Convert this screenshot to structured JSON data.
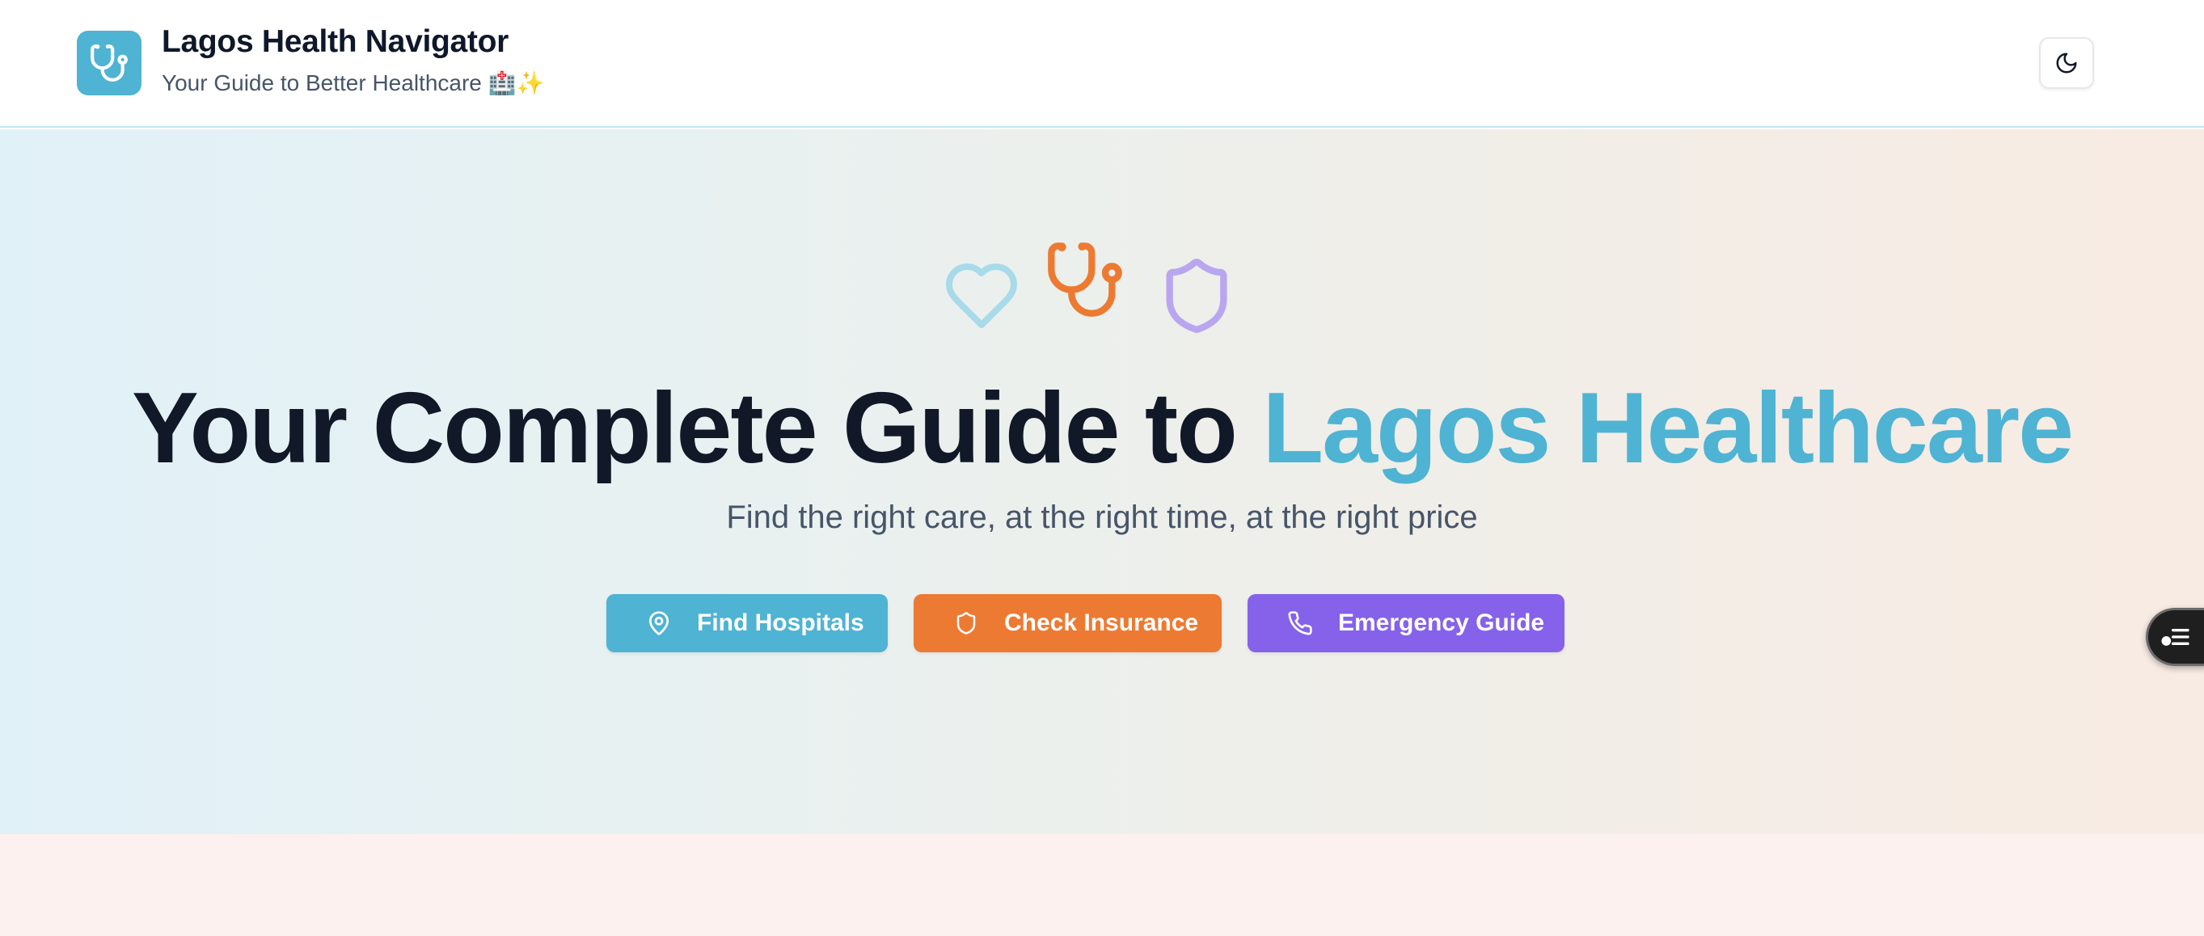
{
  "header": {
    "title": "Lagos Health Navigator",
    "subtitle": "Your Guide to Better Healthcare 🏥✨",
    "logo_icon": "stethoscope-icon",
    "theme_toggle_icon": "moon-icon"
  },
  "hero": {
    "icons": [
      "heart-icon",
      "stethoscope-icon",
      "shield-icon"
    ],
    "title_main": "Your Complete Guide to ",
    "title_accent": "Lagos Healthcare",
    "subtitle": "Find the right care, at the right time, at the right price",
    "buttons": [
      {
        "label": "Find Hospitals",
        "icon": "map-pin-icon",
        "color": "#4fb3d3"
      },
      {
        "label": "Check Insurance",
        "icon": "shield-icon",
        "color": "#ed7a32"
      },
      {
        "label": "Emergency Guide",
        "icon": "phone-icon",
        "color": "#8662ea"
      }
    ]
  },
  "colors": {
    "brand": "#4fb3d3",
    "accent_orange": "#ed7a32",
    "accent_purple": "#8662ea",
    "text_dark": "#111827"
  },
  "floating_widget": {
    "icon": "menu-list-icon"
  }
}
